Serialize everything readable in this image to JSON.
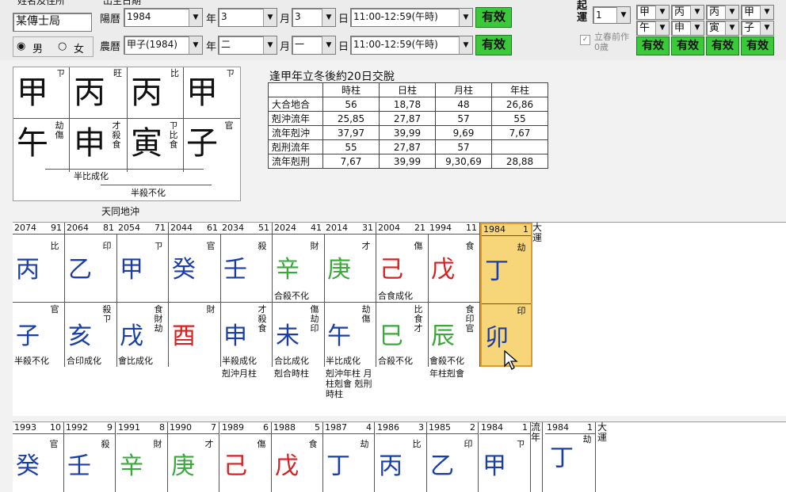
{
  "form": {
    "name_label": "姓名及住所",
    "name_value": "某傳士局",
    "male_label": "男",
    "female_label": "女",
    "date_label": "出生日期",
    "solar_label": "陽曆",
    "solar_year": "1984",
    "year_unit": "年",
    "solar_month": "3",
    "month_unit": "月",
    "solar_day": "3",
    "day_unit": "日",
    "solar_time": "11:00-12:59(午時)",
    "valid_label": "有效",
    "lunar_label": "農曆",
    "lunar_year": "甲子(1984)",
    "lunar_month": "二",
    "lunar_day": "一",
    "lunar_time": "11:00-12:59(午時)",
    "qiyun_label": "起運",
    "qiyun_value": "1",
    "checkbox_label": "立春前作0歲",
    "right_pillars_top": [
      "甲",
      "丙",
      "丙",
      "甲"
    ],
    "right_pillars_bottom": [
      "午",
      "申",
      "寅",
      "子"
    ]
  },
  "natal": {
    "stems": [
      "甲",
      "丙",
      "丙",
      "甲"
    ],
    "stem_marks": [
      "ㄗ",
      "旺",
      "比",
      "ㄗ"
    ],
    "branches": [
      "午",
      "申",
      "寅",
      "子"
    ],
    "branch_notes": [
      "劫傷",
      "才殺食",
      "ㄗ比食",
      "官"
    ],
    "notes": [
      "半比成化",
      "半殺不化",
      "天同地沖"
    ]
  },
  "table": {
    "title": "逢甲年立冬後約20日交脫",
    "headers": [
      "",
      "時柱",
      "日柱",
      "月柱",
      "年柱"
    ],
    "rows": [
      [
        "大合地合",
        "56",
        "18,78",
        "48",
        "26,86"
      ],
      [
        "剋沖流年",
        "25,85",
        "27,87",
        "57",
        "55"
      ],
      [
        "流年剋沖",
        "37,97",
        "39,99",
        "9,69",
        "7,67"
      ],
      [
        "剋刑流年",
        "55",
        "27,87",
        "57",
        ""
      ],
      [
        "流年剋刑",
        "7,67",
        "39,99",
        "9,30,69",
        "28,88"
      ]
    ]
  },
  "dayun": {
    "label": "大運",
    "cols": [
      {
        "year": "2074",
        "age": "91",
        "stem": "丙",
        "stem_color": "#1a3ea8",
        "stem_mark": "比",
        "branch": "子",
        "branch_color": "#1a3ea8",
        "branch_mark": "官",
        "note1": "",
        "note2": "半殺不化",
        "note3": ""
      },
      {
        "year": "2064",
        "age": "81",
        "stem": "乙",
        "stem_color": "#1a3ea8",
        "stem_mark": "印",
        "branch": "亥",
        "branch_color": "#1a3ea8",
        "branch_mark": "殺ㄗ",
        "note1": "",
        "note2": "合印成化",
        "note3": ""
      },
      {
        "year": "2054",
        "age": "71",
        "stem": "甲",
        "stem_color": "#1a3ea8",
        "stem_mark": "ㄗ",
        "branch": "戌",
        "branch_color": "#1a3ea8",
        "branch_mark": "食財劫",
        "note1": "",
        "note2": "會比成化",
        "note3": ""
      },
      {
        "year": "2044",
        "age": "61",
        "stem": "癸",
        "stem_color": "#1a3ea8",
        "stem_mark": "官",
        "branch": "酉",
        "branch_color": "#d62020",
        "branch_mark": "財",
        "note1": "",
        "note2": "",
        "note3": ""
      },
      {
        "year": "2034",
        "age": "51",
        "stem": "壬",
        "stem_color": "#1a3ea8",
        "stem_mark": "殺",
        "branch": "申",
        "branch_color": "#1a3ea8",
        "branch_mark": "才殺食",
        "note1": "",
        "note2": "半殺成化",
        "note3": "剋沖月柱"
      },
      {
        "year": "2024",
        "age": "41",
        "stem": "辛",
        "stem_color": "#3aa83a",
        "stem_mark": "財",
        "branch": "未",
        "branch_color": "#1a3ea8",
        "branch_mark": "傷劫印",
        "note1": "合殺不化",
        "note2": "合比成化",
        "note3": "剋合時柱"
      },
      {
        "year": "2014",
        "age": "31",
        "stem": "庚",
        "stem_color": "#3aa83a",
        "stem_mark": "才",
        "branch": "午",
        "branch_color": "#1a3ea8",
        "branch_mark": "劫傷",
        "note1": "",
        "note2": "半比成化",
        "note3": "剋沖年柱 月柱剋會 剋刑時柱"
      },
      {
        "year": "2004",
        "age": "21",
        "stem": "己",
        "stem_color": "#d62020",
        "stem_mark": "傷",
        "branch": "巳",
        "branch_color": "#3aa83a",
        "branch_mark": "比食才",
        "note1": "合食成化",
        "note2": "合殺不化",
        "note3": ""
      },
      {
        "year": "1994",
        "age": "11",
        "stem": "戊",
        "stem_color": "#d62020",
        "stem_mark": "食",
        "branch": "辰",
        "branch_color": "#3aa83a",
        "branch_mark": "食印官",
        "note1": "",
        "note2": "會殺不化",
        "note3": "年柱剋會"
      },
      {
        "year": "1984",
        "age": "1",
        "stem": "丁",
        "stem_color": "#1a3ea8",
        "stem_mark": "劫",
        "branch": "卯",
        "branch_color": "#1a3ea8",
        "branch_mark": "印",
        "note1": "",
        "note2": "",
        "note3": ""
      }
    ]
  },
  "liunian": {
    "label": "流年",
    "label2": "大運",
    "cols": [
      {
        "year": "1993",
        "age": "10",
        "stem": "癸",
        "color": "#1a3ea8",
        "mark": "官"
      },
      {
        "year": "1992",
        "age": "9",
        "stem": "壬",
        "color": "#1a3ea8",
        "mark": "殺"
      },
      {
        "year": "1991",
        "age": "8",
        "stem": "辛",
        "color": "#3aa83a",
        "mark": "財"
      },
      {
        "year": "1990",
        "age": "7",
        "stem": "庚",
        "color": "#3aa83a",
        "mark": "才"
      },
      {
        "year": "1989",
        "age": "6",
        "stem": "己",
        "color": "#d62020",
        "mark": "傷"
      },
      {
        "year": "1988",
        "age": "5",
        "stem": "戊",
        "color": "#d62020",
        "mark": "食"
      },
      {
        "year": "1987",
        "age": "4",
        "stem": "丁",
        "color": "#1a3ea8",
        "mark": "劫"
      },
      {
        "year": "1986",
        "age": "3",
        "stem": "丙",
        "color": "#1a3ea8",
        "mark": "比"
      },
      {
        "year": "1985",
        "age": "2",
        "stem": "乙",
        "color": "#1a3ea8",
        "mark": "印"
      },
      {
        "year": "1984",
        "age": "1",
        "stem": "甲",
        "color": "#1a3ea8",
        "mark": "ㄗ"
      }
    ],
    "dayun_year": "1984",
    "dayun_age": "1",
    "dayun_stem": "丁",
    "dayun_mark": "劫"
  }
}
